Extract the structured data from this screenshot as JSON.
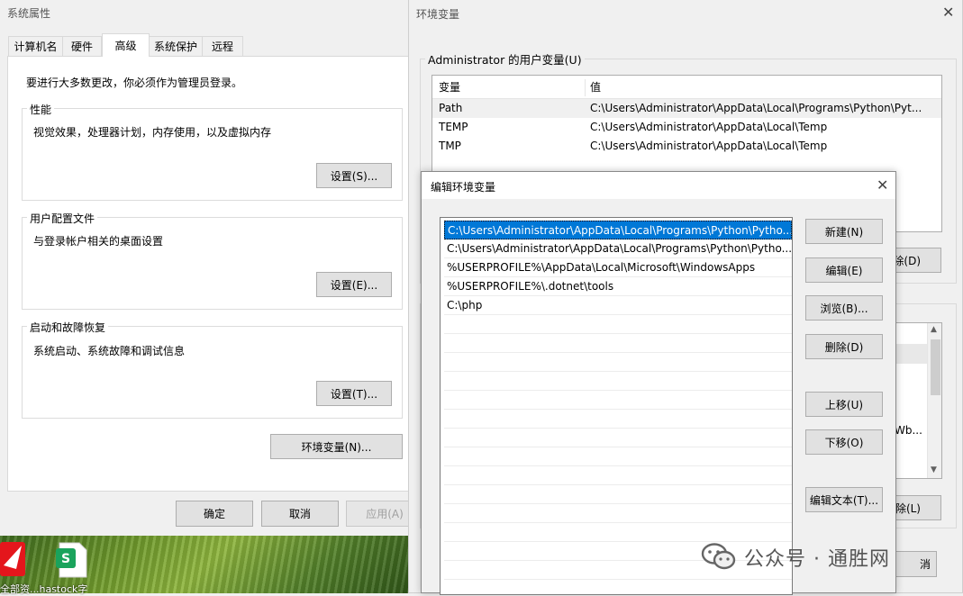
{
  "sys_props": {
    "title": "系统属性",
    "tabs": [
      "计算机名",
      "硬件",
      "高级",
      "系统保护",
      "远程"
    ],
    "admin_note": "要进行大多数更改，你必须作为管理员登录。",
    "perf": {
      "legend": "性能",
      "desc": "视觉效果，处理器计划，内存使用，以及虚拟内存",
      "button": "设置(S)..."
    },
    "profile": {
      "legend": "用户配置文件",
      "desc": "与登录帐户相关的桌面设置",
      "button": "设置(E)..."
    },
    "startup": {
      "legend": "启动和故障恢复",
      "desc": "系统启动、系统故障和调试信息",
      "button": "设置(T)..."
    },
    "env_button": "环境变量(N)...",
    "ok": "确定",
    "cancel": "取消",
    "apply": "应用(A)"
  },
  "env_vars": {
    "title": "环境变量",
    "user_group": "Administrator 的用户变量(U)",
    "columns": [
      "变量",
      "值"
    ],
    "rows": [
      {
        "name": "Path",
        "value": "C:\\Users\\Administrator\\AppData\\Local\\Programs\\Python\\Pyt..."
      },
      {
        "name": "TEMP",
        "value": "C:\\Users\\Administrator\\AppData\\Local\\Temp"
      },
      {
        "name": "TMP",
        "value": "C:\\Users\\Administrator\\AppData\\Local\\Temp"
      }
    ],
    "delete_user_partial": "除(D)",
    "sys_partial_text": "Wb...",
    "delete_sys_partial": "除(L)",
    "cancel_partial": "消"
  },
  "edit_env": {
    "title": "编辑环境变量",
    "entries": [
      "C:\\Users\\Administrator\\AppData\\Local\\Programs\\Python\\Pytho...",
      "C:\\Users\\Administrator\\AppData\\Local\\Programs\\Python\\Pytho...",
      "%USERPROFILE%\\AppData\\Local\\Microsoft\\WindowsApps",
      "%USERPROFILE%\\.dotnet\\tools",
      "C:\\php"
    ],
    "buttons": {
      "new": "新建(N)",
      "edit": "编辑(E)",
      "browse": "浏览(B)...",
      "delete": "删除(D)",
      "up": "上移(U)",
      "down": "下移(O)",
      "edit_text": "编辑文本(T)..."
    }
  },
  "desktop": {
    "icon_label": "全部资...hastock字"
  },
  "watermark": {
    "text": "公众号 · 通胜网"
  },
  "colors": {
    "selection": "#0078d7",
    "button_face": "#e1e1e1",
    "window_bg": "#f0f0f0"
  }
}
